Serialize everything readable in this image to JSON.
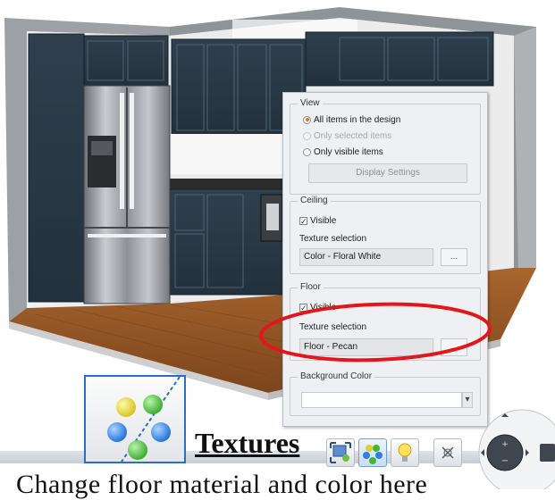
{
  "view_group": {
    "title": "View",
    "options": [
      "All items in the design",
      "Only selected items",
      "Only visible items"
    ],
    "selected_index": 0,
    "disabled_index": 1,
    "display_settings_label": "Display Settings"
  },
  "ceiling_group": {
    "title": "Ceiling",
    "visible_label": "Visible",
    "visible_checked": true,
    "texture_label": "Texture selection",
    "texture_value": "Color - Floral White",
    "browse_label": "..."
  },
  "floor_group": {
    "title": "Floor",
    "visible_label": "Visible",
    "visible_checked": true,
    "texture_label": "Texture selection",
    "texture_value": "Floor - Pecan",
    "browse_label": "..."
  },
  "background_group": {
    "title": "Background Color",
    "color_value": "",
    "dropdown_arrow": "▾"
  },
  "callout": {
    "label": "Textures",
    "icon": "textures-icon",
    "highlight_color": "#e5161b",
    "frame_color": "#2a6fc4"
  },
  "toolbar": {
    "icons": [
      "fit-view-icon",
      "textures-icon",
      "lightbulb-icon",
      "crosshair-icon"
    ]
  },
  "navigation": {
    "icon": "navigation-wheel-icon",
    "zoom_in": "+",
    "zoom_out": "−"
  },
  "bottom_caption": "Change floor material and color here"
}
